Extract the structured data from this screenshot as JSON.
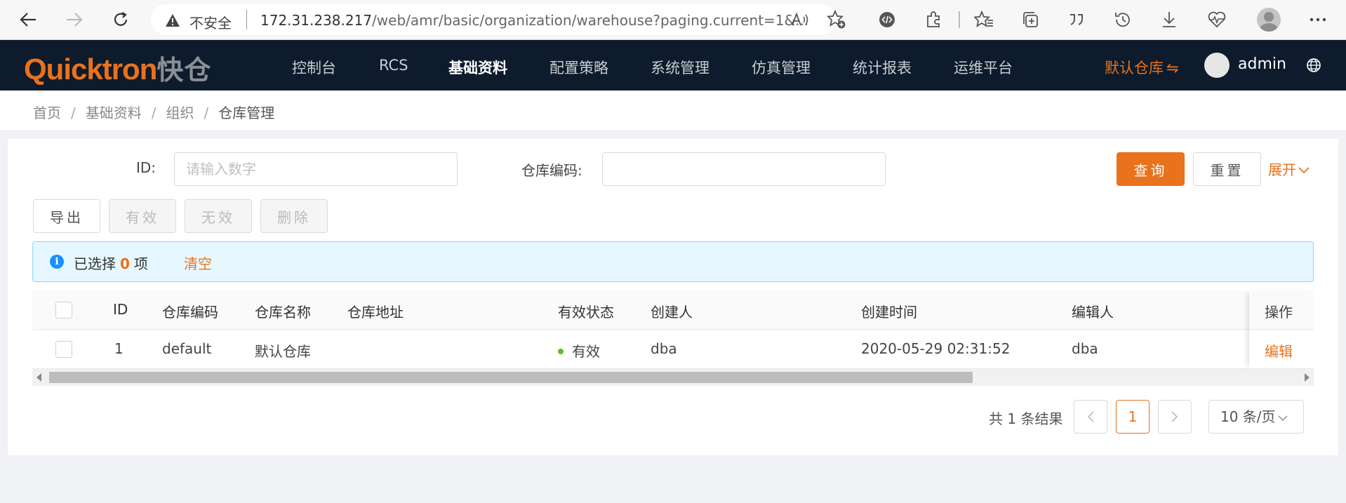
{
  "browser": {
    "insecure_label": "不安全",
    "url_host": "172.31.238.217",
    "url_path": "/web/amr/basic/organization/warehouse?paging.current=1&..."
  },
  "app": {
    "logo_text": "Quicktron",
    "logo_cn": "快仓",
    "menu": [
      "控制台",
      "RCS",
      "基础资料",
      "配置策略",
      "系统管理",
      "仿真管理",
      "统计报表",
      "运维平台"
    ],
    "active_menu_index": 2,
    "warehouse_switch": "默认仓库",
    "user": "admin"
  },
  "breadcrumb": [
    "首页",
    "基础资料",
    "组织",
    "仓库管理"
  ],
  "filters": {
    "id_label": "ID:",
    "id_placeholder": "请输入数字",
    "code_label": "仓库编码:",
    "code_value": "",
    "query": "查询",
    "reset": "重置",
    "expand": "展开"
  },
  "actions": {
    "export": "导出",
    "valid": "有效",
    "invalid": "无效",
    "delete": "删除"
  },
  "selection": {
    "prefix": "已选择",
    "count": "0",
    "suffix": "项",
    "clear": "清空"
  },
  "table": {
    "headers": [
      "ID",
      "仓库编码",
      "仓库名称",
      "仓库地址",
      "有效状态",
      "创建人",
      "创建时间",
      "编辑人",
      "操作"
    ],
    "rows": [
      {
        "id": "1",
        "code": "default",
        "name": "默认仓库",
        "address": "",
        "status": "有效",
        "creator": "dba",
        "created": "2020-05-29 02:31:52",
        "editor": "dba",
        "action": "编辑"
      }
    ]
  },
  "pagination": {
    "total": "共 1 条结果",
    "current": "1",
    "page_size": "10 条/页"
  },
  "colors": {
    "accent": "#e9721c",
    "header_bg": "#0d1b2d",
    "status_green": "#52c41a",
    "info_blue": "#1890ff"
  }
}
